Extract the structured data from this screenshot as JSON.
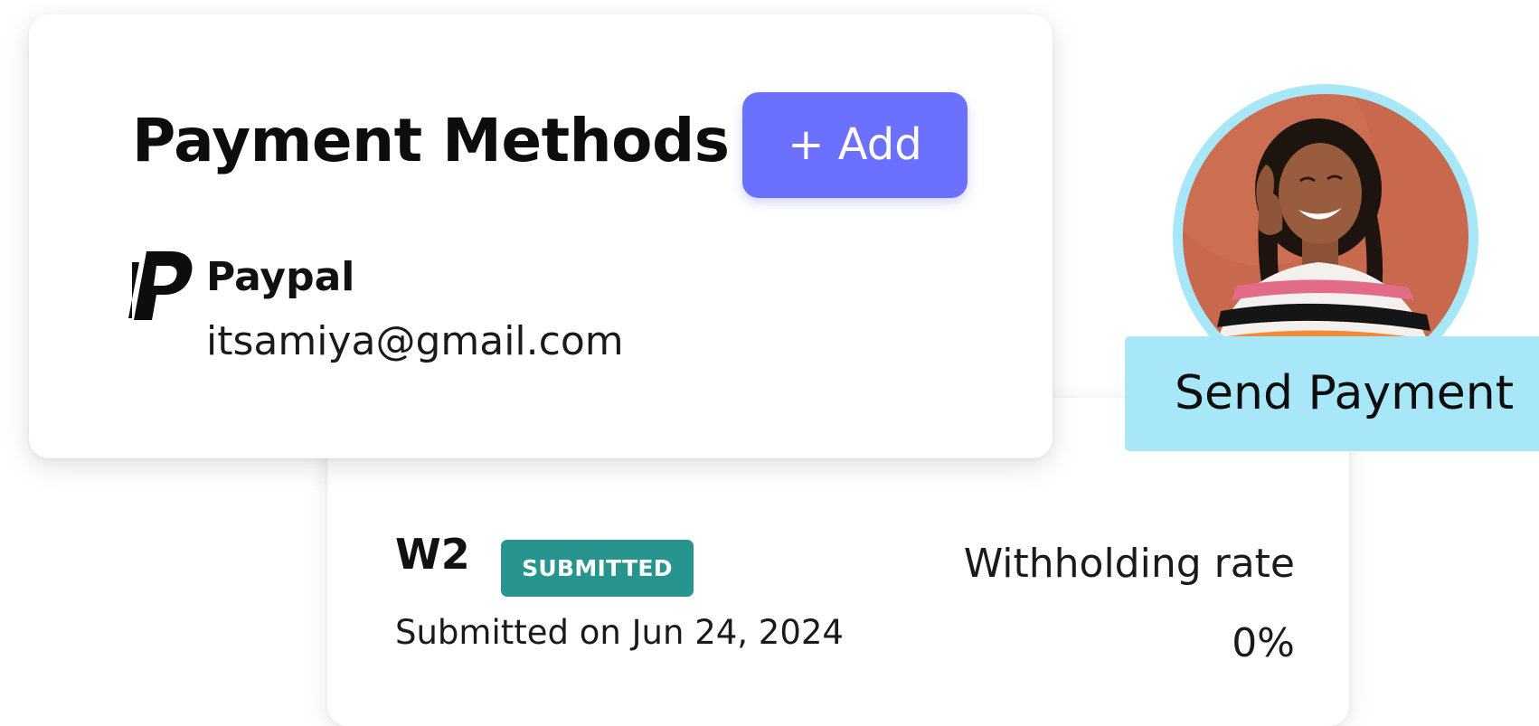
{
  "payment_methods": {
    "title": "Payment Methods",
    "add_button_label": "+ Add",
    "method": {
      "name": "Paypal",
      "email": "itsamiya@gmail.com",
      "icon": "paypal-icon"
    }
  },
  "tax_form": {
    "form_name": "W2",
    "status": "SUBMITTED",
    "submitted_text": "Submitted on Jun 24, 2024",
    "rate_label": "Withholding rate",
    "rate_value": "0%"
  },
  "payee": {
    "send_button_label": "Send Payment",
    "avatar": "avatar-photo"
  },
  "colors": {
    "accent": "#6b70ff",
    "status_badge": "#27948d",
    "send_payment": "#a8e7f8"
  }
}
